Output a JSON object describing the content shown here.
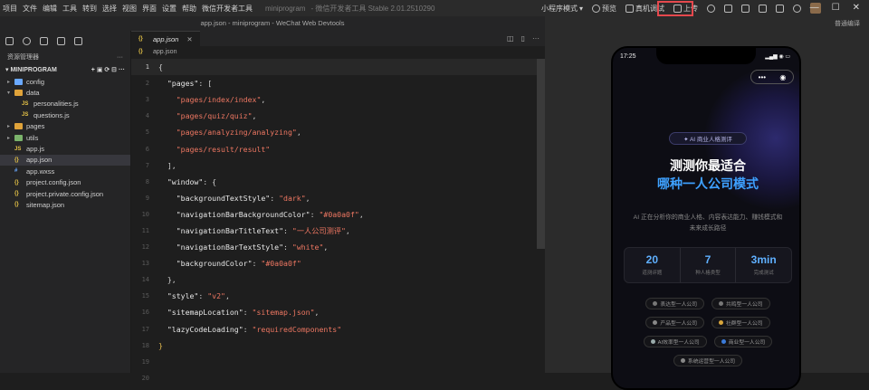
{
  "menu": [
    "项目",
    "文件",
    "编辑",
    "工具",
    "转到",
    "选择",
    "视图",
    "界面",
    "设置",
    "帮助",
    "微信开发者工具"
  ],
  "menu_project": "miniprogram",
  "menu_version": "- 微信开发者工具 Stable 2.01.2510290",
  "toolbar": {
    "mode": "小程序模式",
    "preview": "预览",
    "real_debug": "真机调试",
    "upload": "上传"
  },
  "titlebar": "app.json - miniprogram - WeChat Web Devtools",
  "sidebar": {
    "header": "资源管理器",
    "project": "MINIPROGRAM",
    "items": [
      {
        "label": "config",
        "kind": "folder",
        "depth": 1,
        "color": "#6aa9ff"
      },
      {
        "label": "data",
        "kind": "folder-open",
        "depth": 1,
        "color": "#e0a33a"
      },
      {
        "label": "personalities.js",
        "kind": "js",
        "depth": 2
      },
      {
        "label": "questions.js",
        "kind": "js",
        "depth": 2
      },
      {
        "label": "pages",
        "kind": "folder",
        "depth": 1,
        "color": "#e0a33a"
      },
      {
        "label": "utils",
        "kind": "folder",
        "depth": 1,
        "color": "#7bb36b"
      },
      {
        "label": "app.js",
        "kind": "js",
        "depth": 1
      },
      {
        "label": "app.json",
        "kind": "json",
        "depth": 1,
        "selected": true
      },
      {
        "label": "app.wxss",
        "kind": "wxss",
        "depth": 1
      },
      {
        "label": "project.config.json",
        "kind": "json",
        "depth": 1
      },
      {
        "label": "project.private.config.json",
        "kind": "json",
        "depth": 1
      },
      {
        "label": "sitemap.json",
        "kind": "json",
        "depth": 1
      }
    ]
  },
  "editor": {
    "tab": "app.json",
    "breadcrumb": "app.json",
    "lines": [
      [
        [
          "{",
          "pu"
        ]
      ],
      [
        [
          "  ",
          ""
        ],
        [
          "\"pages\"",
          "k"
        ],
        [
          ": [",
          "pu"
        ]
      ],
      [
        [
          "    ",
          ""
        ],
        [
          "\"pages/index/index\"",
          "s"
        ],
        [
          ",",
          "pu"
        ]
      ],
      [
        [
          "    ",
          ""
        ],
        [
          "\"pages/quiz/quiz\"",
          "s"
        ],
        [
          ",",
          "pu"
        ]
      ],
      [
        [
          "    ",
          ""
        ],
        [
          "\"pages/analyzing/analyzing\"",
          "s"
        ],
        [
          ",",
          "pu"
        ]
      ],
      [
        [
          "    ",
          ""
        ],
        [
          "\"pages/result/result\"",
          "s"
        ]
      ],
      [
        [
          "  ],",
          "pu"
        ]
      ],
      [
        [
          "  ",
          ""
        ],
        [
          "\"window\"",
          "k"
        ],
        [
          ": {",
          "pu"
        ]
      ],
      [
        [
          "    ",
          ""
        ],
        [
          "\"backgroundTextStyle\"",
          "k"
        ],
        [
          ": ",
          "pu"
        ],
        [
          "\"dark\"",
          "s"
        ],
        [
          ",",
          "pu"
        ]
      ],
      [
        [
          "    ",
          ""
        ],
        [
          "\"navigationBarBackgroundColor\"",
          "k"
        ],
        [
          ": ",
          "pu"
        ],
        [
          "\"#0a0a0f\"",
          "s"
        ],
        [
          ",",
          "pu"
        ]
      ],
      [
        [
          "    ",
          ""
        ],
        [
          "\"navigationBarTitleText\"",
          "k"
        ],
        [
          ": ",
          "pu"
        ],
        [
          "\"一人公司测评\"",
          "s"
        ],
        [
          ",",
          "pu"
        ]
      ],
      [
        [
          "    ",
          ""
        ],
        [
          "\"navigationBarTextStyle\"",
          "k"
        ],
        [
          ": ",
          "pu"
        ],
        [
          "\"white\"",
          "s"
        ],
        [
          ",",
          "pu"
        ]
      ],
      [
        [
          "    ",
          ""
        ],
        [
          "\"backgroundColor\"",
          "k"
        ],
        [
          ": ",
          "pu"
        ],
        [
          "\"#0a0a0f\"",
          "s"
        ]
      ],
      [
        [
          "  },",
          "pu"
        ]
      ],
      [
        [
          "  ",
          ""
        ],
        [
          "\"style\"",
          "k"
        ],
        [
          ": ",
          "pu"
        ],
        [
          "\"v2\"",
          "s"
        ],
        [
          ",",
          "pu"
        ]
      ],
      [
        [
          "  ",
          ""
        ],
        [
          "\"sitemapLocation\"",
          "k"
        ],
        [
          ": ",
          "pu"
        ],
        [
          "\"sitemap.json\"",
          "s"
        ],
        [
          ",",
          "pu"
        ]
      ],
      [
        [
          "  ",
          ""
        ],
        [
          "\"lazyCodeLoading\"",
          "k"
        ],
        [
          ": ",
          "pu"
        ],
        [
          "\"requiredComponents\"",
          "s"
        ]
      ],
      [
        [
          "}",
          "p"
        ]
      ],
      [
        [
          "",
          ""
        ]
      ],
      [
        [
          "",
          ""
        ]
      ]
    ]
  },
  "simulator": {
    "top_label": "普通编译",
    "time": "17:25",
    "badge": "✦ AI 商业人格测评",
    "hero_line1": "测测你最适合",
    "hero_line2": "哪种一人公司模式",
    "desc": "AI 正在分析你的商业人格、内容表达能力、赚钱模式和未来成长路径",
    "stats": [
      {
        "value": "20",
        "label": "道测评题"
      },
      {
        "value": "7",
        "label": "种人格类型"
      },
      {
        "value": "3min",
        "label": "完成测试"
      }
    ],
    "chips": [
      [
        {
          "label": "表达型一人公司",
          "color": "#777"
        },
        {
          "label": "共鸣型一人公司",
          "color": "#777"
        }
      ],
      [
        {
          "label": "产品型一人公司",
          "color": "#888"
        },
        {
          "label": "社群型一人公司",
          "color": "#d9a63b"
        }
      ],
      [
        {
          "label": "AI效率型一人公司",
          "color": "#9aa"
        },
        {
          "label": "商业型一人公司",
          "color": "#3b7bd9"
        }
      ],
      [
        {
          "label": "系统运营型一人公司",
          "color": "#888"
        }
      ]
    ]
  }
}
